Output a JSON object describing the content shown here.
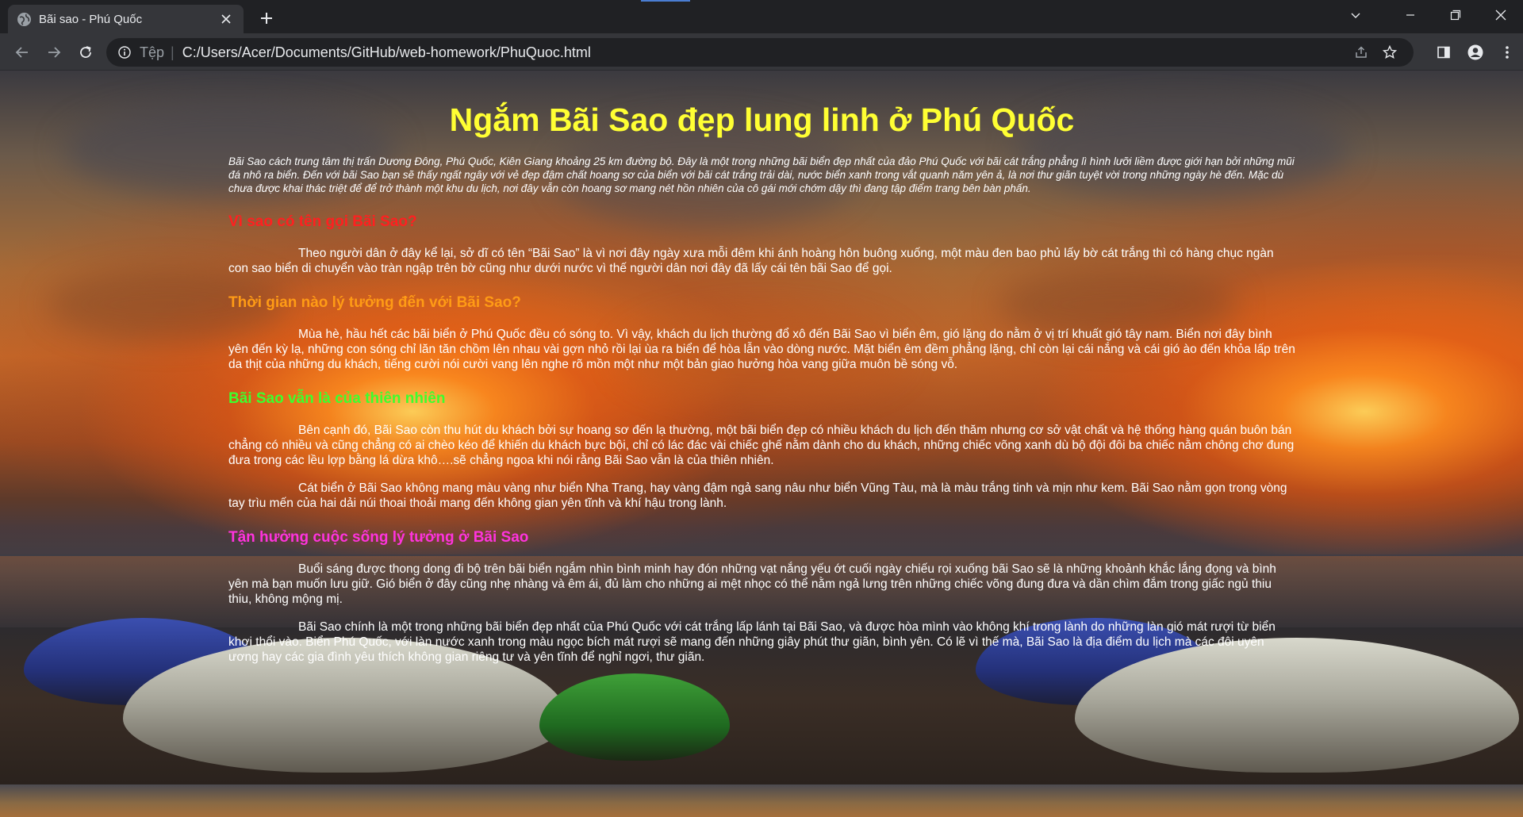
{
  "browser": {
    "tab_title": "Bãi sao - Phú Quốc",
    "scheme_label": "Tệp",
    "separator": "|",
    "url": "C:/Users/Acer/Documents/GitHub/web-homework/PhuQuoc.html",
    "theme_color": "#35363a"
  },
  "page": {
    "title": "Ngắm Bãi Sao đẹp lung linh ở Phú Quốc",
    "intro": "Bãi Sao cách trung tâm thị trấn Dương Đông, Phú Quốc, Kiên Giang khoảng 25 km đường bộ. Đây là một trong những bãi biển đẹp nhất của đảo Phú Quốc với bãi cát trắng phẳng lì hình lưỡi liềm được giới hạn bởi những mũi đá nhô ra biển. Đến với bãi Sao bạn sẽ thấy ngất ngây với vẻ đẹp đậm chất hoang sơ của biển với bãi cát trắng trải dài, nước biển xanh trong vắt quanh năm yên ả, là nơi thư giãn tuyệt vời trong những ngày hè đến. Mặc dù chưa được khai thác triệt để để trở thành một khu du lịch, nơi đây vẫn còn hoang sơ mang nét hồn nhiên của cô gái mới chớm dậy thì đang tập điểm trang bên bàn phấn.",
    "sections": [
      {
        "heading": "Vì sao có tên gọi Bãi Sao?",
        "paragraphs": [
          "Theo người dân ở đây kể lại, sở dĩ có tên “Bãi Sao” là vì nơi đây ngày xưa mỗi đêm khi ánh hoàng hôn buông xuống, một màu đen bao phủ lấy bờ cát trắng thì có hàng chục ngàn con sao biển di chuyển vào tràn ngập trên bờ cũng như dưới nước vì thế người dân nơi đây đã lấy cái tên bãi Sao để gọi."
        ]
      },
      {
        "heading": "Thời gian nào lý tưởng đến với Bãi Sao?",
        "paragraphs": [
          "Mùa hè, hầu hết các bãi biển ở Phú Quốc đều có sóng to. Vì vậy, khách du lịch thường đổ xô đến Bãi Sao vì biển êm, gió lặng do nằm ở vị trí khuất gió tây nam. Biển nơi đây bình yên đến kỳ lạ, những con sóng chỉ lăn tăn chồm lên nhau vài gợn nhỏ rồi lại ùa ra biển để hòa lẫn vào dòng nước. Mặt biển êm đềm phẳng lặng, chỉ còn lại cái nắng và cái gió ào đến khỏa lấp trên da thịt của những du khách, tiếng cười nói cười vang lên nghe rõ mồn một như một bản giao hưởng hòa vang giữa muôn bề sóng vỗ."
        ]
      },
      {
        "heading": "Bãi Sao vẫn là của thiên nhiên",
        "paragraphs": [
          "Bên cạnh đó, Bãi Sao còn thu hút du khách bởi sự hoang sơ đến lạ thường, một bãi biển đẹp có nhiều khách du lịch đến thăm nhưng cơ sở vật chất và hệ thống hàng quán buôn bán chẳng có nhiều và cũng chẳng có ai chèo kéo để khiến du khách bực bội, chỉ có lác đác vài chiếc ghế nằm dành cho du khách, những chiếc võng xanh dù bộ đội đôi ba chiếc nằm chông chơ đung đưa trong các lều lợp bằng lá dừa khô….sẽ chẳng ngoa khi nói rằng Bãi Sao vẫn là của thiên nhiên.",
          "Cát biển ở Bãi Sao không mang màu vàng như biển Nha Trang, hay vàng đậm ngả sang nâu như biển Vũng Tàu, mà là màu trắng tinh và mịn như kem. Bãi Sao nằm gọn trong vòng tay trìu mến của hai dải núi thoai thoải mang đến không gian yên tĩnh và khí hậu trong lành."
        ]
      },
      {
        "heading": "Tận hưởng cuộc sống lý tưởng ở Bãi Sao",
        "paragraphs": [
          "Buổi sáng được thong dong đi bộ trên bãi biển ngắm nhìn bình minh hay đón những vạt nắng yếu ớt cuối ngày chiếu rọi xuống bãi Sao sẽ là những khoảnh khắc lắng đọng và bình yên mà bạn muốn lưu giữ. Gió biển ở đây cũng nhẹ nhàng và êm ái, đủ làm cho những ai mệt nhọc có thể nằm ngả lưng trên những chiếc võng đung đưa và dần chìm đắm trong giấc ngủ thiu thiu, không mộng mị.",
          "Bãi Sao chính là một trong những bãi biển đẹp nhất của Phú Quốc với cát trắng lấp lánh tại Bãi Sao, và được hòa mình vào không khí trong lành do những làn gió mát rượi từ biển khơi thổi vào. Biển Phú Quốc, với làn nước xanh trong màu ngọc bích mát rượi sẽ mang đến những giây phút thư giãn, bình yên. Có lẽ vì thế mà, Bãi Sao là địa điểm du lịch mà các đôi uyên ương hay các gia đình yêu thích không gian riêng tư và yên tĩnh để nghỉ ngơi, thư giãn."
        ]
      }
    ],
    "colors": {
      "title": "#ffff33",
      "heading_1": "#ff2020",
      "heading_2": "#ff9b15",
      "heading_3": "#3dff2e",
      "heading_4": "#ff33dd",
      "body_text": "#ffffff"
    }
  }
}
